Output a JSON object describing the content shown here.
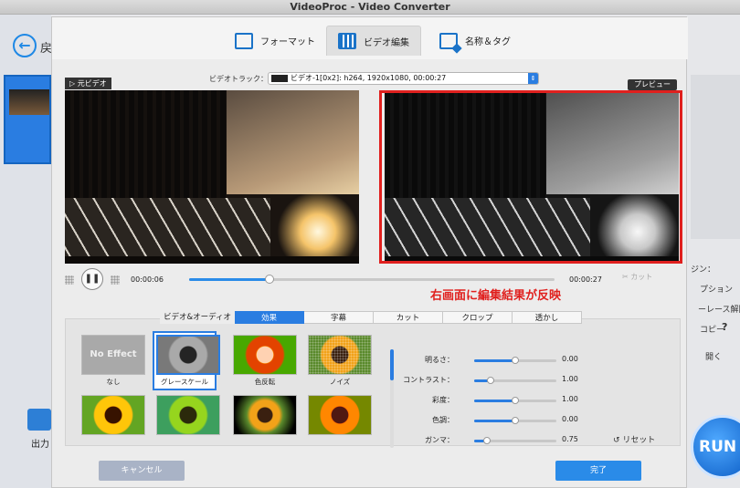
{
  "window": {
    "title": "VideoProc - Video Converter"
  },
  "background_app": {
    "back_label": "戻",
    "output_label": "出力",
    "right_panel": [
      "ジン：",
      "プション",
      "ーレース解除",
      "コピー",
      "?",
      "開く"
    ],
    "run_label": "RUN"
  },
  "dialog": {
    "tabs": [
      {
        "label": "フォーマット",
        "icon": "format-icon",
        "active": false
      },
      {
        "label": "ビデオ編集",
        "icon": "film-edit-icon",
        "active": true
      },
      {
        "label": "名称＆タグ",
        "icon": "tag-icon",
        "active": false
      }
    ],
    "track_label": "ビデオトラック：",
    "track_value": "ビデオ-1[0x2]: h264, 1920x1080, 00:00:27",
    "original_label": "▷ 元ビデオ",
    "preview_button": "プレビュー",
    "playback": {
      "current_time": "00:00:06",
      "end_time": "00:00:27",
      "progress": 0.22,
      "cut_label": "✂ カット",
      "pause_icon": "pause-icon"
    },
    "annotation": "右画面に編集結果が反映",
    "sub_tabs": [
      "ビデオ&オーディオ",
      "効果",
      "字幕",
      "カット",
      "クロップ",
      "透かし"
    ],
    "active_sub_tab": "効果",
    "effects": [
      {
        "label": "なし",
        "thumb_text": "No Effect"
      },
      {
        "label": "グレースケール",
        "selected": true
      },
      {
        "label": "色反転"
      },
      {
        "label": "ノイズ"
      },
      {
        "label": ""
      },
      {
        "label": ""
      },
      {
        "label": ""
      },
      {
        "label": ""
      }
    ],
    "adjustments": [
      {
        "name": "明るさ：",
        "value": "0.00",
        "level": 0.5
      },
      {
        "name": "コントラスト：",
        "value": "1.00",
        "level": 0.2
      },
      {
        "name": "彩度：",
        "value": "1.00",
        "level": 0.5
      },
      {
        "name": "色調：",
        "value": "0.00",
        "level": 0.5
      },
      {
        "name": "ガンマ：",
        "value": "0.75",
        "level": 0.15
      }
    ],
    "reset_label": "リセット",
    "cancel_label": "キャンセル",
    "done_label": "完了"
  }
}
